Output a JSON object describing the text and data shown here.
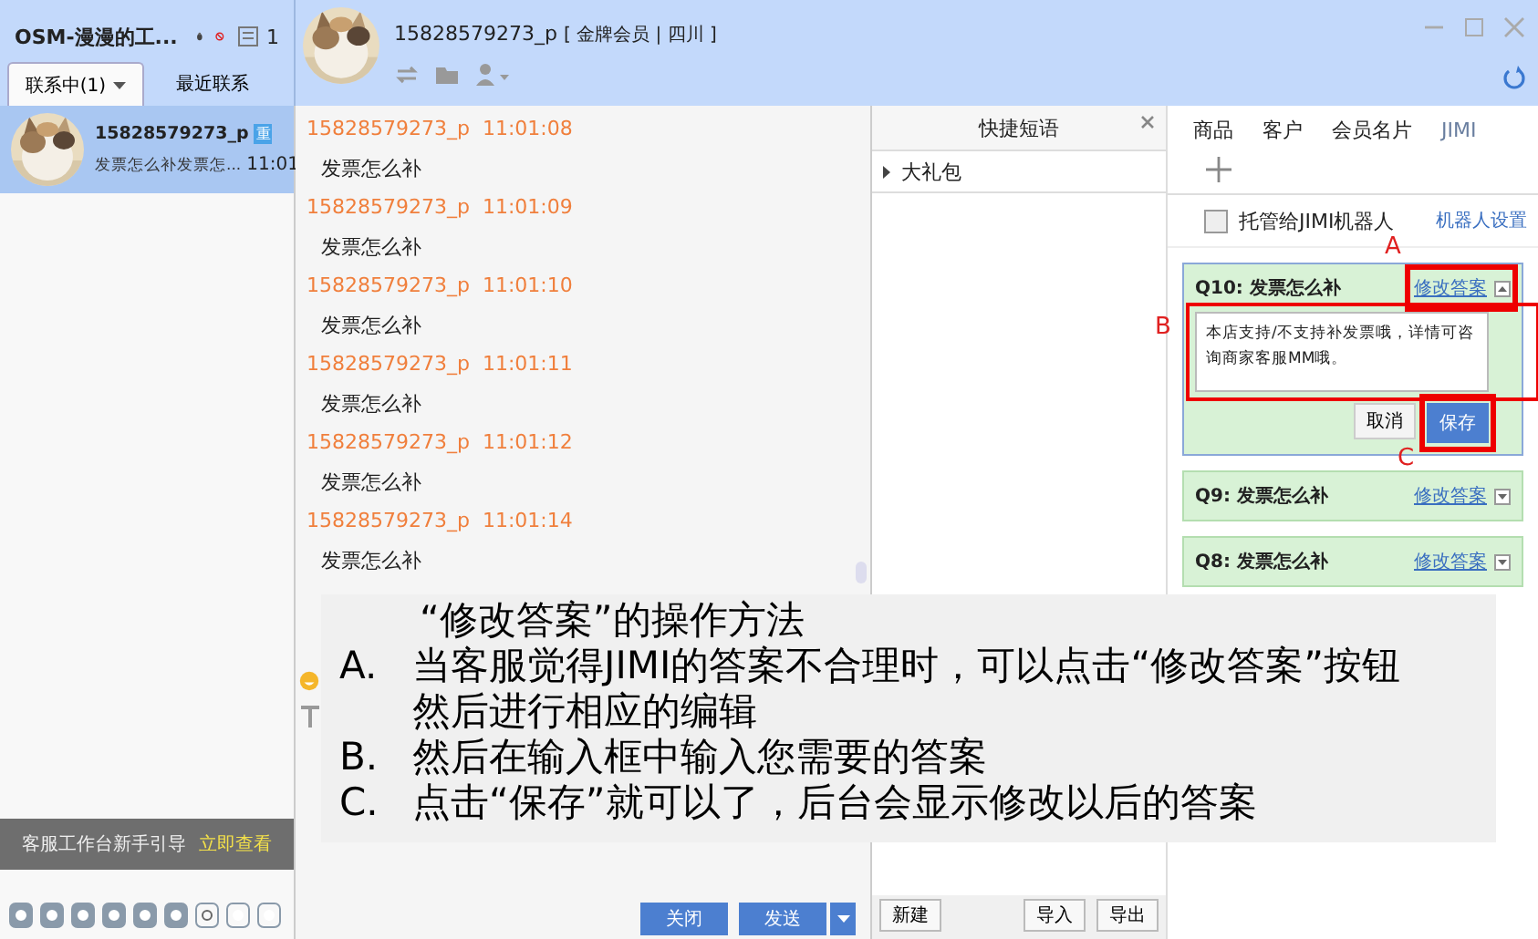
{
  "sidebar": {
    "title": "OSM-漫漫的工...",
    "badge_count": "1",
    "tabs": [
      {
        "label": "联系中(1)",
        "selected": true
      },
      {
        "label": "最近联系",
        "selected": false
      }
    ],
    "contacts": [
      {
        "name": "15828579273_p",
        "badge": "重",
        "preview": "发票怎么补发票怎...",
        "time": "11:01",
        "selected": true
      }
    ],
    "guide": {
      "text": "客服工作台新手引导",
      "link": "立即查看"
    }
  },
  "chat": {
    "name": "15828579273_p",
    "tags": "[ 金牌会员 | 四川 ]",
    "messages": [
      {
        "sender": "15828579273_p",
        "time": "11:01:08",
        "text": "发票怎么补"
      },
      {
        "sender": "15828579273_p",
        "time": "11:01:09",
        "text": "发票怎么补"
      },
      {
        "sender": "15828579273_p",
        "time": "11:01:10",
        "text": "发票怎么补"
      },
      {
        "sender": "15828579273_p",
        "time": "11:01:11",
        "text": "发票怎么补"
      },
      {
        "sender": "15828579273_p",
        "time": "11:01:12",
        "text": "发票怎么补"
      },
      {
        "sender": "15828579273_p",
        "time": "11:01:14",
        "text": "发票怎么补"
      }
    ],
    "buttons": [
      "关闭",
      "发送"
    ]
  },
  "quick_phrases": {
    "title": "快捷短语",
    "groups": [
      {
        "label": "大礼包",
        "expanded": false
      }
    ],
    "buttons": [
      "新建",
      "导入",
      "导出"
    ]
  },
  "right_panel": {
    "tabs": [
      {
        "label": "商品",
        "selected": false
      },
      {
        "label": "客户",
        "selected": false
      },
      {
        "label": "会员名片",
        "selected": false
      },
      {
        "label": "JIMI",
        "selected": true
      }
    ],
    "robot": {
      "label": "托管给JIMI机器人",
      "checked": false,
      "settings_link": "机器人设置"
    },
    "questions": [
      {
        "title": "Q10: 发票怎么补",
        "link": "修改答案",
        "expanded": true,
        "answer": "本店支持/不支持补发票哦，详情可咨询商家客服MM哦。",
        "buttons": [
          "取消",
          "保存"
        ]
      },
      {
        "title": "Q9: 发票怎么补",
        "link": "修改答案",
        "expanded": false
      },
      {
        "title": "Q8: 发票怎么补",
        "link": "修改答案",
        "expanded": false
      }
    ]
  },
  "annotations": [
    "A",
    "B",
    "C"
  ],
  "instructions": {
    "title": "“修改答案”的操作方法",
    "items": [
      {
        "marker": "A.",
        "text": "当客服觉得JIMI的答案不合理时，可以点击“修改答案”按钮然后进行相应的编辑"
      },
      {
        "marker": "B.",
        "text": "然后在输入框中输入您需要的答案"
      },
      {
        "marker": "C.",
        "text": "点击“保存”就可以了，后台会显示修改以后的答案"
      }
    ]
  }
}
